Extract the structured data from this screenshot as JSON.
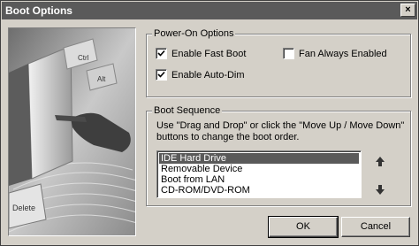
{
  "window": {
    "title": "Boot Options",
    "close_glyph": "×"
  },
  "hero_image": {
    "labels": [
      "Ctrl",
      "Alt",
      "Delete"
    ]
  },
  "power_on": {
    "legend": "Power-On Options",
    "options": [
      {
        "label": "Enable Fast Boot",
        "checked": true
      },
      {
        "label": "Fan Always Enabled",
        "checked": false
      },
      {
        "label": "Enable Auto-Dim",
        "checked": true
      }
    ]
  },
  "boot_sequence": {
    "legend": "Boot Sequence",
    "description": "Use \"Drag and Drop\" or click the \"Move Up / Move Down\" buttons to change the boot order.",
    "items": [
      "IDE Hard Drive",
      "Removable Device",
      "Boot from LAN",
      "CD-ROM/DVD-ROM"
    ],
    "selected_index": 0,
    "move_up_icon": "arrow-up-icon",
    "move_down_icon": "arrow-down-icon"
  },
  "buttons": {
    "ok": "OK",
    "cancel": "Cancel"
  },
  "colors": {
    "titlebar": "#5a5a5a",
    "face": "#d4d0c8",
    "selection": "#5a5a5a"
  }
}
